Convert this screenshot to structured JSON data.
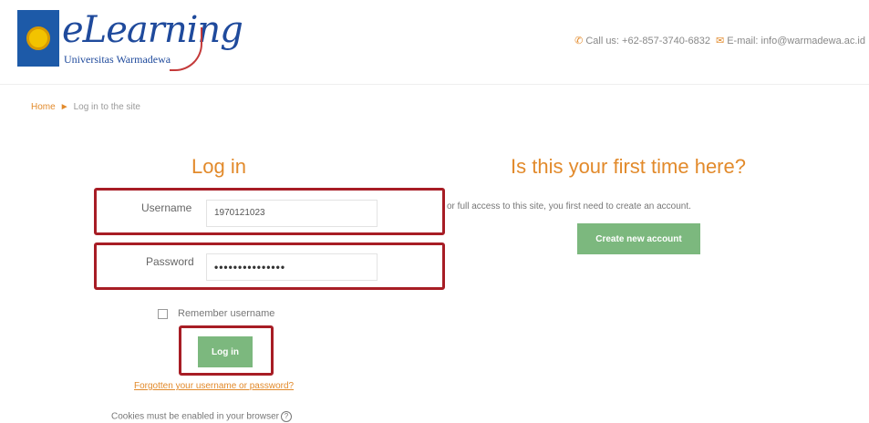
{
  "header": {
    "logo_title": "eLearning",
    "logo_subtitle": "Universitas Warmadewa",
    "phone_icon": "phone-icon",
    "phone_text": "Call us: +62-857-3740-6832",
    "email_icon": "envelope-icon",
    "email_text": "E-mail: info@warmadewa.ac.id"
  },
  "breadcrumb": {
    "home": "Home",
    "separator": "►",
    "current": "Log in to the site"
  },
  "login": {
    "heading": "Log in",
    "username_label": "Username",
    "username_value": "1970121023",
    "password_label": "Password",
    "password_value": "•••••••••••••••",
    "remember_label": "Remember username",
    "login_button": "Log in",
    "forgot_link": "Forgotten your username or password?",
    "cookies_text": "Cookies must be enabled in your browser",
    "help_icon": "?"
  },
  "signup": {
    "heading": "Is this your first time here?",
    "text": "or full access to this site, you first need to create an account.",
    "button": "Create new account"
  },
  "colors": {
    "accent": "#e28a2b",
    "button": "#7cb87e",
    "highlight_box": "#a71d25",
    "logo_blue": "#1f4a9c"
  }
}
